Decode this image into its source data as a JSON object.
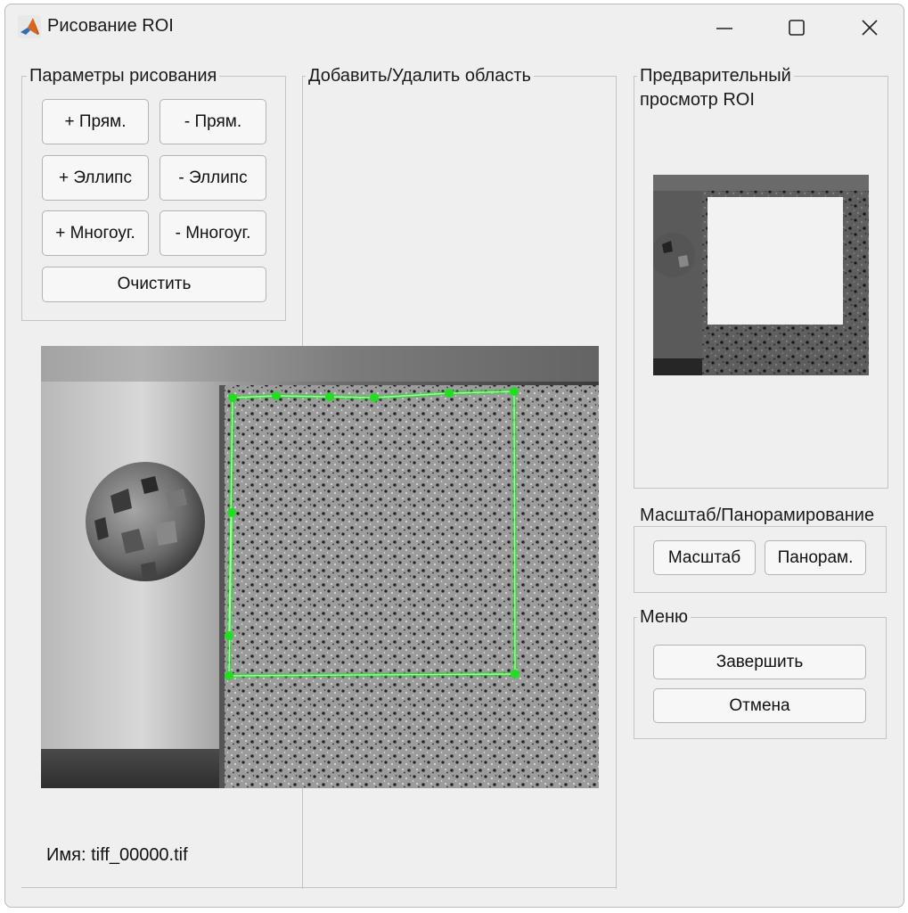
{
  "window": {
    "title": "Рисование ROI",
    "icon": "matlab-icon",
    "controls": [
      "minimize-icon",
      "maximize-icon",
      "close-icon"
    ]
  },
  "draw_params": {
    "title": "Параметры рисования",
    "add_rect": "+ Прям.",
    "sub_rect": "- Прям.",
    "add_ellipse": "+ Эллипс",
    "sub_ellipse": "- Эллипс",
    "add_poly": "+ Многоуг.",
    "sub_poly": "- Многоуг.",
    "clear": "Очистить"
  },
  "add_remove": {
    "title": "Добавить/Удалить область"
  },
  "preview": {
    "title_line1": "Предварительный",
    "title_line2": "просмотр ROI"
  },
  "zoom_pan": {
    "title": "Масштаб/Панорамирование",
    "zoom": "Масштаб",
    "pan": "Панорам."
  },
  "menu": {
    "title": "Меню",
    "finish": "Завершить",
    "cancel": "Отмена"
  },
  "status": {
    "filename": "Имя: tiff_00000.tif"
  },
  "colors": {
    "roi_outline": "#22dd22",
    "window_bg": "#efefef",
    "preview_roi_fill": "#f2f2f2"
  }
}
